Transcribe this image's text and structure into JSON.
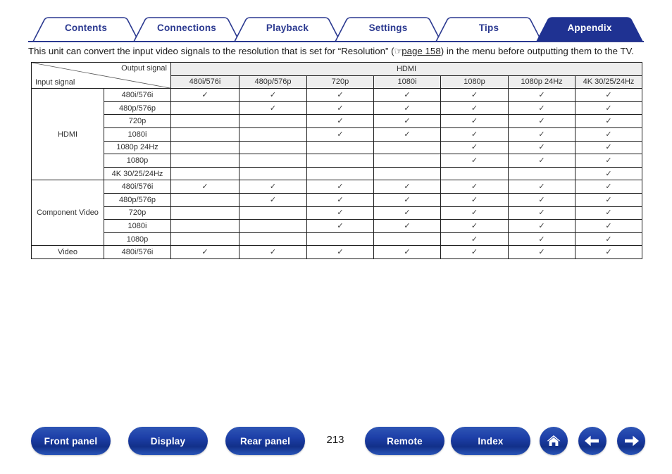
{
  "tabs": [
    {
      "label": "Contents",
      "active": false
    },
    {
      "label": "Connections",
      "active": false
    },
    {
      "label": "Playback",
      "active": false
    },
    {
      "label": "Settings",
      "active": false
    },
    {
      "label": "Tips",
      "active": false
    },
    {
      "label": "Appendix",
      "active": true
    }
  ],
  "intro": {
    "before_link": "This unit can convert the input video signals to the resolution that is set for “Resolution” (",
    "hand_icon": "☞",
    "link_text": "page 158",
    "after_link": ") in the menu before outputting them to the TV."
  },
  "table": {
    "corner_output_label": "Output signal",
    "corner_input_label": "Input signal",
    "output_group": "HDMI",
    "output_columns": [
      "480i/576i",
      "480p/576p",
      "720p",
      "1080i",
      "1080p",
      "1080p 24Hz",
      "4K 30/25/24Hz"
    ],
    "check_mark": "✓",
    "groups": [
      {
        "name": "HDMI",
        "rows": [
          {
            "label": "480i/576i",
            "checks": [
              true,
              true,
              true,
              true,
              true,
              true,
              true
            ]
          },
          {
            "label": "480p/576p",
            "checks": [
              false,
              true,
              true,
              true,
              true,
              true,
              true
            ]
          },
          {
            "label": "720p",
            "checks": [
              false,
              false,
              true,
              true,
              true,
              true,
              true
            ]
          },
          {
            "label": "1080i",
            "checks": [
              false,
              false,
              true,
              true,
              true,
              true,
              true
            ]
          },
          {
            "label": "1080p 24Hz",
            "checks": [
              false,
              false,
              false,
              false,
              true,
              true,
              true
            ]
          },
          {
            "label": "1080p",
            "checks": [
              false,
              false,
              false,
              false,
              true,
              true,
              true
            ]
          },
          {
            "label": "4K 30/25/24Hz",
            "checks": [
              false,
              false,
              false,
              false,
              false,
              false,
              true
            ]
          }
        ]
      },
      {
        "name": "Component Video",
        "rows": [
          {
            "label": "480i/576i",
            "checks": [
              true,
              true,
              true,
              true,
              true,
              true,
              true
            ]
          },
          {
            "label": "480p/576p",
            "checks": [
              false,
              true,
              true,
              true,
              true,
              true,
              true
            ]
          },
          {
            "label": "720p",
            "checks": [
              false,
              false,
              true,
              true,
              true,
              true,
              true
            ]
          },
          {
            "label": "1080i",
            "checks": [
              false,
              false,
              true,
              true,
              true,
              true,
              true
            ]
          },
          {
            "label": "1080p",
            "checks": [
              false,
              false,
              false,
              false,
              true,
              true,
              true
            ]
          }
        ]
      },
      {
        "name": "Video",
        "rows": [
          {
            "label": "480i/576i",
            "checks": [
              true,
              true,
              true,
              true,
              true,
              true,
              true
            ]
          }
        ]
      }
    ]
  },
  "bottom_nav": {
    "buttons": [
      {
        "label": "Front panel"
      },
      {
        "label": "Display"
      },
      {
        "label": "Rear panel"
      },
      {
        "label": "Remote"
      },
      {
        "label": "Index"
      }
    ],
    "page_number": "213",
    "icons": [
      "home-icon",
      "back-arrow-icon",
      "forward-arrow-icon"
    ]
  },
  "colors": {
    "brand_blue": "#2b3990",
    "active_tab": "#1f3292",
    "button_blue": "#1d3fa8",
    "table_header_bg": "#eeeeee",
    "table_border": "#1e1e1e"
  }
}
